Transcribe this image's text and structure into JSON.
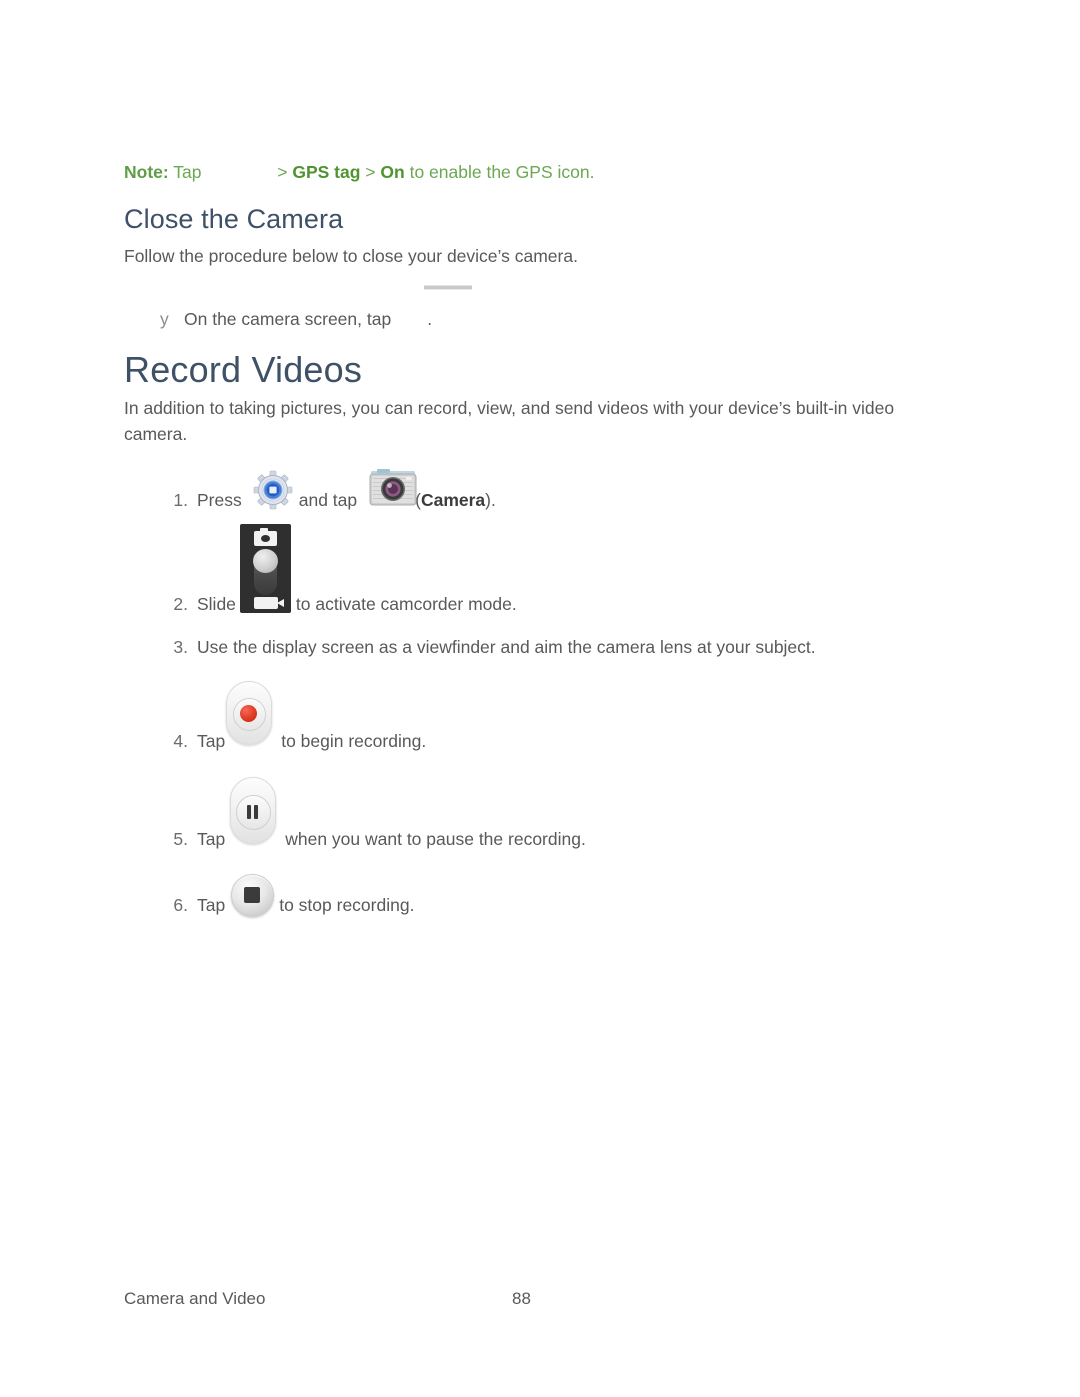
{
  "document": {
    "note": {
      "label": "Note:",
      "lead": "Tap",
      "icon_placeholder": "",
      "sep1": ">",
      "menu_item": "GPS tag",
      "sep2": ">",
      "value": "On",
      "tail": "to enable the GPS icon.",
      "color": "#5f9e46"
    },
    "section_close_camera": {
      "heading": "Close the Camera",
      "intro": "Follow the procedure below to close your device’s camera.",
      "bullet": {
        "marker": "y",
        "text_before": "On the camera screen, tap",
        "text_after": "."
      },
      "heading_color": "#3f5167"
    },
    "section_record_videos": {
      "heading": "Record Videos",
      "intro": "In addition to taking pictures, you can record, view, and send videos with your device’s built-in video camera.",
      "steps": [
        {
          "number": "1.",
          "text_before": "Press",
          "text_middle": "and tap",
          "text_bold": "Camera",
          "text_after": ").",
          "open_paren": "(",
          "icons": [
            "gear-icon",
            "camera-app-icon"
          ]
        },
        {
          "number": "2.",
          "text_before": "Slide",
          "text_after": "to activate camcorder mode.",
          "icons": [
            "camcorder-slider-icon"
          ]
        },
        {
          "number": "3.",
          "text_before": "Use the display screen as a viewfinder and aim the camera lens at your subject.",
          "text_after": "",
          "icons": []
        },
        {
          "number": "4.",
          "text_before": "Tap",
          "text_after": "to begin recording.",
          "icons": [
            "record-button-icon"
          ]
        },
        {
          "number": "5.",
          "text_before": "Tap",
          "text_after": "when you want to pause the recording.",
          "icons": [
            "pause-button-icon"
          ]
        },
        {
          "number": "6.",
          "text_before": "Tap",
          "text_after": "to stop recording.",
          "icons": [
            "stop-button-icon"
          ]
        }
      ]
    },
    "footer": {
      "chapter": "Camera and Video",
      "page_number": "88"
    }
  }
}
